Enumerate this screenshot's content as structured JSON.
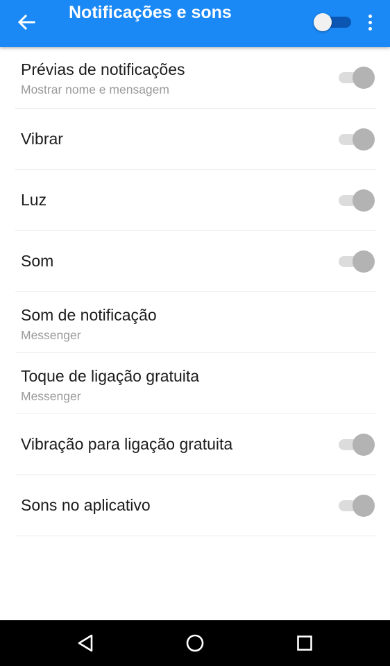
{
  "app_bar": {
    "title": "Notificações e sons",
    "back_icon": "arrow-left-icon",
    "master_toggle_on": false,
    "overflow_icon": "more-vertical-icon"
  },
  "settings": [
    {
      "title": "Prévias de notificações",
      "subtitle": "Mostrar nome e mensagem",
      "toggle": true
    },
    {
      "title": "Vibrar",
      "toggle": true
    },
    {
      "title": "Luz",
      "toggle": true
    },
    {
      "title": "Som",
      "toggle": true
    },
    {
      "title": "Som de notificação",
      "subtitle": "Messenger"
    },
    {
      "title": "Toque de ligação gratuita",
      "subtitle": "Messenger"
    },
    {
      "title": "Vibração para ligação gratuita",
      "toggle": true
    },
    {
      "title": "Sons no aplicativo",
      "toggle": true
    }
  ],
  "nav_bar": {
    "back_icon": "triangle-back-icon",
    "home_icon": "circle-home-icon",
    "recents_icon": "square-recents-icon"
  },
  "colors": {
    "app_bar": "#1a88f5",
    "toggle_track": "#dcdcdc",
    "toggle_thumb": "#b3b3b3",
    "nav_bar": "#000000"
  }
}
